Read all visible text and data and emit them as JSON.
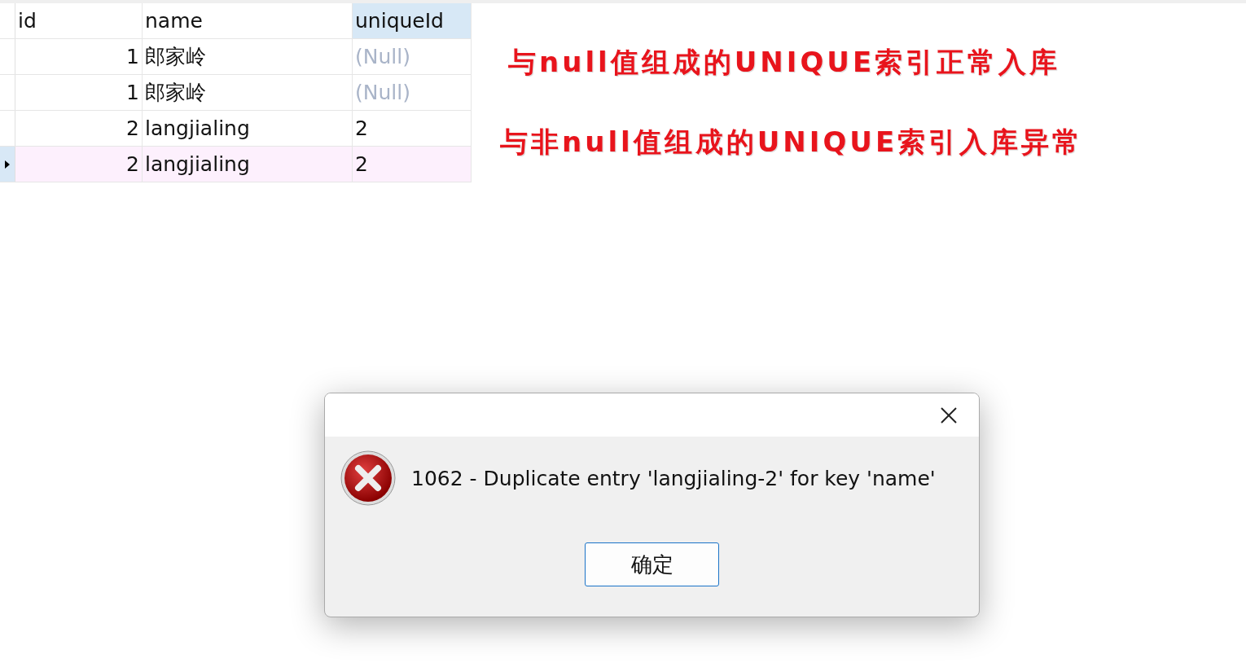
{
  "table": {
    "columns": [
      "id",
      "name",
      "uniqueId"
    ],
    "rows": [
      {
        "selected": false,
        "cells": [
          {
            "text": "1",
            "null": false
          },
          {
            "text": "郎家岭",
            "null": false
          },
          {
            "text": "(Null)",
            "null": true
          }
        ]
      },
      {
        "selected": false,
        "cells": [
          {
            "text": "1",
            "null": false
          },
          {
            "text": "郎家岭",
            "null": false
          },
          {
            "text": "(Null)",
            "null": true
          }
        ]
      },
      {
        "selected": false,
        "cells": [
          {
            "text": "2",
            "null": false
          },
          {
            "text": "langjialing",
            "null": false
          },
          {
            "text": "2",
            "null": false
          }
        ]
      },
      {
        "selected": true,
        "cells": [
          {
            "text": "2",
            "null": false
          },
          {
            "text": "langjialing",
            "null": false
          },
          {
            "text": "2",
            "null": false
          }
        ]
      }
    ]
  },
  "annotations": [
    "与null值组成的UNIQUE索引正常入库",
    "与非null值组成的UNIQUE索引入库异常"
  ],
  "dialog": {
    "message": "1062 - Duplicate entry 'langjialing-2' for key 'name'",
    "button": "确定"
  }
}
